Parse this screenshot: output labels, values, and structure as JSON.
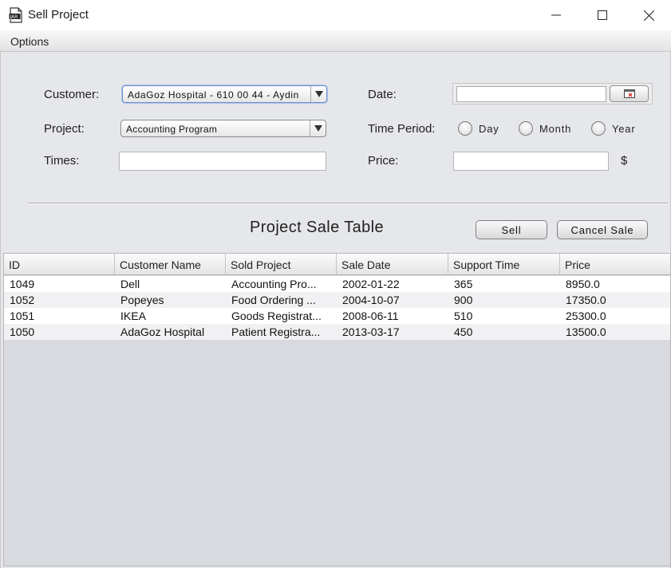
{
  "window": {
    "title": "Sell Project",
    "icon": "jar-file-icon"
  },
  "menu": {
    "options_label": "Options"
  },
  "form": {
    "customer_label": "Customer:",
    "customer_value": "AdaGoz Hospital -  610 00 44 - Aydin",
    "project_label": "Project:",
    "project_value": "Accounting Program",
    "times_label": "Times:",
    "times_value": "",
    "date_label": "Date:",
    "date_value": "",
    "time_period_label": "Time Period:",
    "period_options": [
      "Day",
      "Month",
      "Year"
    ],
    "price_label": "Price:",
    "price_value": "",
    "currency": "$"
  },
  "section": {
    "title": "Project Sale Table",
    "sell_label": "Sell",
    "cancel_label": "Cancel Sale"
  },
  "table": {
    "columns": [
      "ID",
      "Customer Name",
      "Sold Project",
      "Sale Date",
      "Support Time",
      "Price"
    ],
    "rows": [
      [
        "1049",
        "Dell",
        "Accounting Pro...",
        "2002-01-22",
        "365",
        "8950.0"
      ],
      [
        "1052",
        "Popeyes",
        "Food Ordering ...",
        "2004-10-07",
        "900",
        "17350.0"
      ],
      [
        "1051",
        "IKEA",
        "Goods Registrat...",
        "2008-06-11",
        "510",
        "25300.0"
      ],
      [
        "1050",
        "AdaGoz Hospital",
        "Patient Registra...",
        "2013-03-17",
        "450",
        "13500.0"
      ]
    ]
  },
  "colors": {
    "content_bg": "#e6e7ea",
    "table_empty_bg": "#d8dae0",
    "focus_border": "#6d8fc9"
  }
}
